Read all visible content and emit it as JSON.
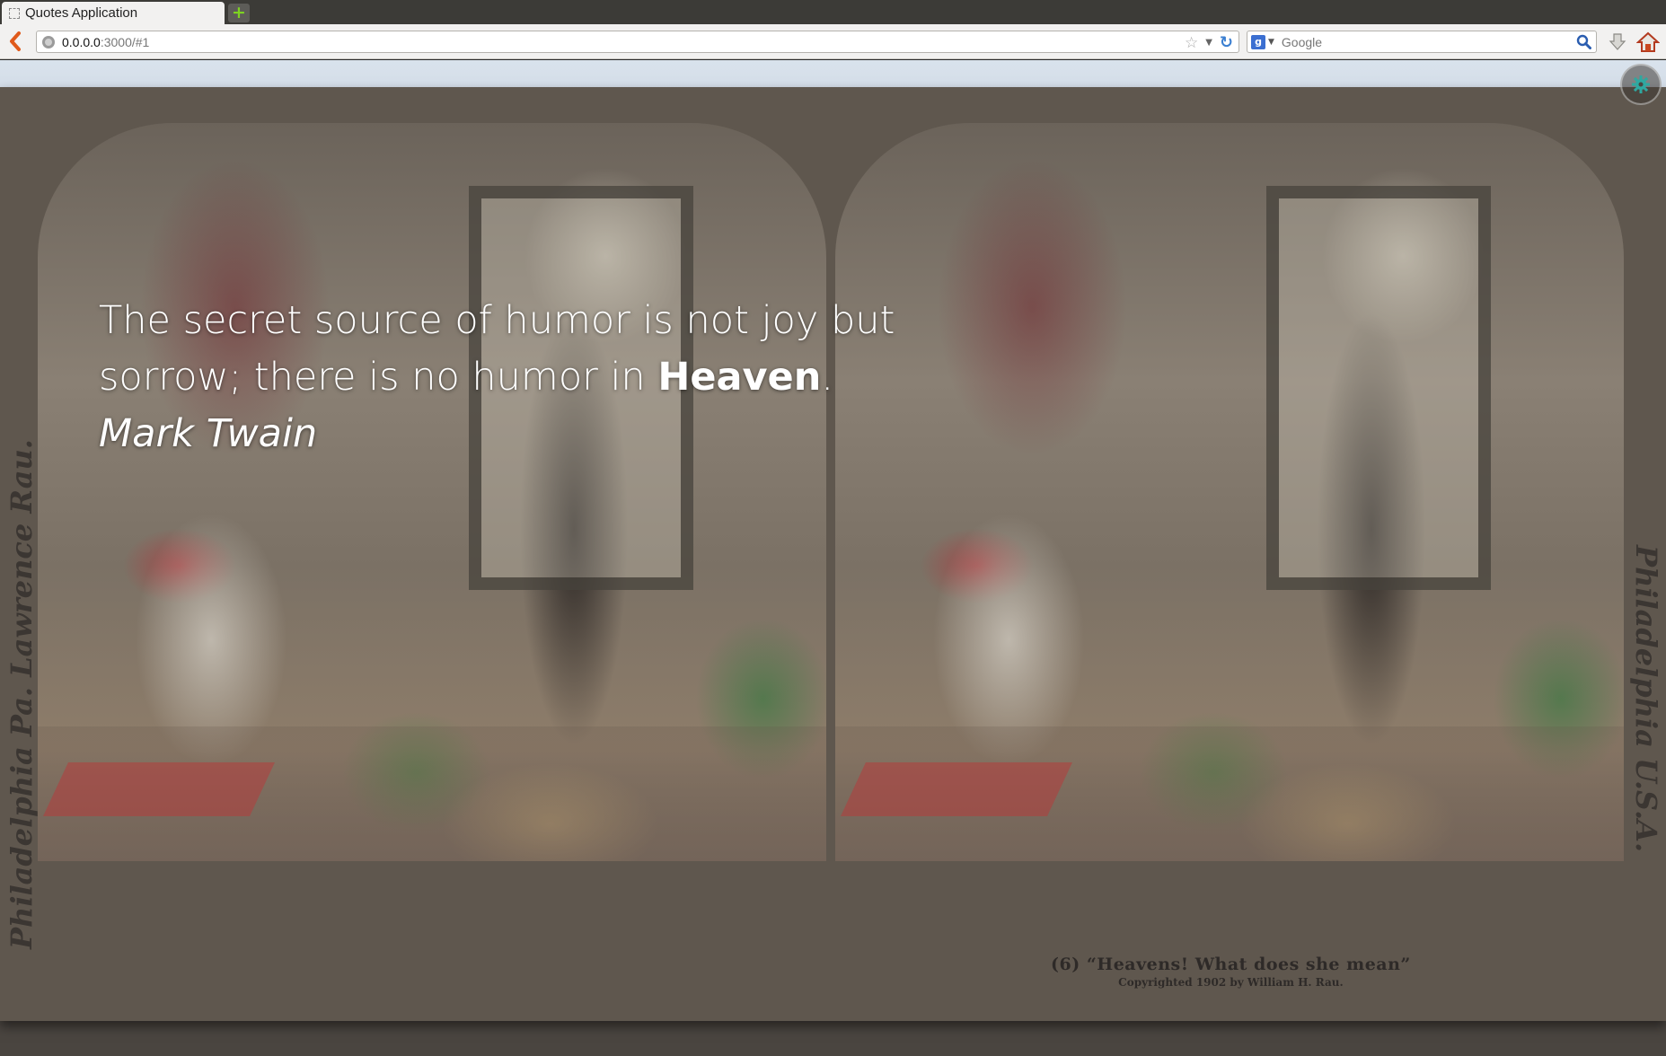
{
  "browser": {
    "tab_title": "Quotes Application",
    "new_tab_symbol": "+",
    "url_host": "0.0.0.0",
    "url_rest": ":3000/#1",
    "search_engine_letter": "g",
    "search_placeholder": "Google"
  },
  "quote": {
    "text_before": "The secret source of humor is not joy but sorrow; there is no humor in ",
    "emphasis": "Heaven",
    "text_after": ". ",
    "author": "Mark Twain"
  },
  "background": {
    "caption_main": "(6) “Heavens!  What does she mean”",
    "caption_copyright": "Copyrighted 1902 by William H. Rau.",
    "side_label_left": "Philadelphia Pa. Lawrence Rau.",
    "side_label_right": "Philadelphia U.S.A."
  },
  "colors": {
    "accent_settings": "#2fa8a0",
    "back_arrow": "#e05a1b"
  },
  "icons": {
    "settings": "gear-icon",
    "back": "back-arrow-icon",
    "reload": "reload-icon",
    "home": "home-icon",
    "download": "download-icon",
    "search": "magnifier-icon"
  }
}
